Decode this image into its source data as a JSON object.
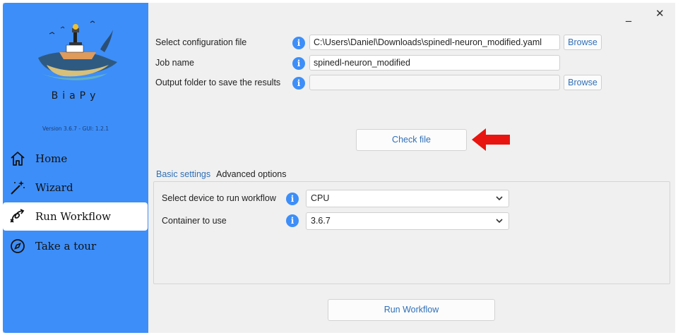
{
  "app": {
    "brand": "BiaPy",
    "version": "Version 3.6.7 - GUI: 1.2.1"
  },
  "sidebar": {
    "items": [
      {
        "label": "Home",
        "icon": "home-icon"
      },
      {
        "label": "Wizard",
        "icon": "magic-wand-icon"
      },
      {
        "label": "Run Workflow",
        "icon": "workflow-icon",
        "active": true
      },
      {
        "label": "Take a tour",
        "icon": "compass-icon"
      }
    ]
  },
  "window_controls": {
    "minimize": "_",
    "close": "✕"
  },
  "form": {
    "config_label": "Select configuration file",
    "config_value": "C:\\Users\\Daniel\\Downloads\\spinedl-neuron_modified.yaml",
    "config_browse": "Browse",
    "jobname_label": "Job name",
    "jobname_value": "spinedl-neuron_modified",
    "output_label": "Output folder to save the results",
    "output_value": "",
    "output_browse": "Browse",
    "info_glyph": "i",
    "check_file": "Check file"
  },
  "tabs": {
    "basic": "Basic settings",
    "advanced": "Advanced options"
  },
  "settings": {
    "device_label": "Select device to run workflow",
    "device_value": "CPU",
    "container_label": "Container to use",
    "container_value": "3.6.7"
  },
  "run_button": "Run Workflow",
  "colors": {
    "sidebar": "#3d8ef8",
    "accent_text": "#2f6fb7",
    "arrow": "#e8140f"
  }
}
